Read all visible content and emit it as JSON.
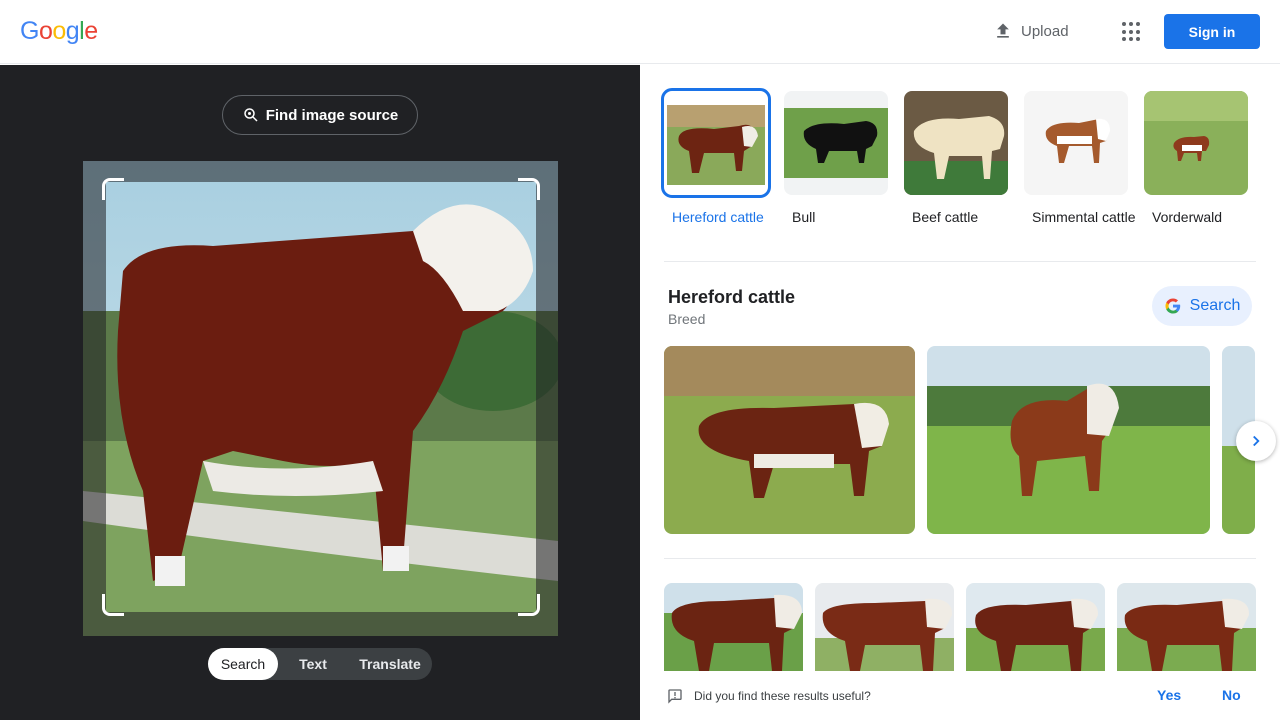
{
  "header": {
    "logo_letters": [
      "G",
      "o",
      "o",
      "g",
      "l",
      "e"
    ],
    "logo_colors": [
      "#4285f4",
      "#ea4335",
      "#fbbc05",
      "#4285f4",
      "#34a853",
      "#ea4335"
    ],
    "upload_label": "Upload",
    "signin_label": "Sign in"
  },
  "lens": {
    "find_source_label": "Find image source",
    "modes": [
      {
        "label": "Search",
        "active": true
      },
      {
        "label": "Text",
        "active": false
      },
      {
        "label": "Translate",
        "active": false
      }
    ]
  },
  "results": {
    "chips": [
      {
        "label": "Hereford cattle",
        "selected": true
      },
      {
        "label": "Bull",
        "selected": false
      },
      {
        "label": "Beef cattle",
        "selected": false
      },
      {
        "label": "Simmental cattle",
        "selected": false
      },
      {
        "label": "Vorderwald",
        "selected": false
      }
    ],
    "entity": {
      "title": "Hereford cattle",
      "subtitle": "Breed",
      "search_label": "Search"
    },
    "feedback": {
      "question": "Did you find these results useful?",
      "yes": "Yes",
      "no": "No"
    }
  },
  "colors": {
    "accent": "#1a73e8",
    "dark_panel": "#202124"
  }
}
